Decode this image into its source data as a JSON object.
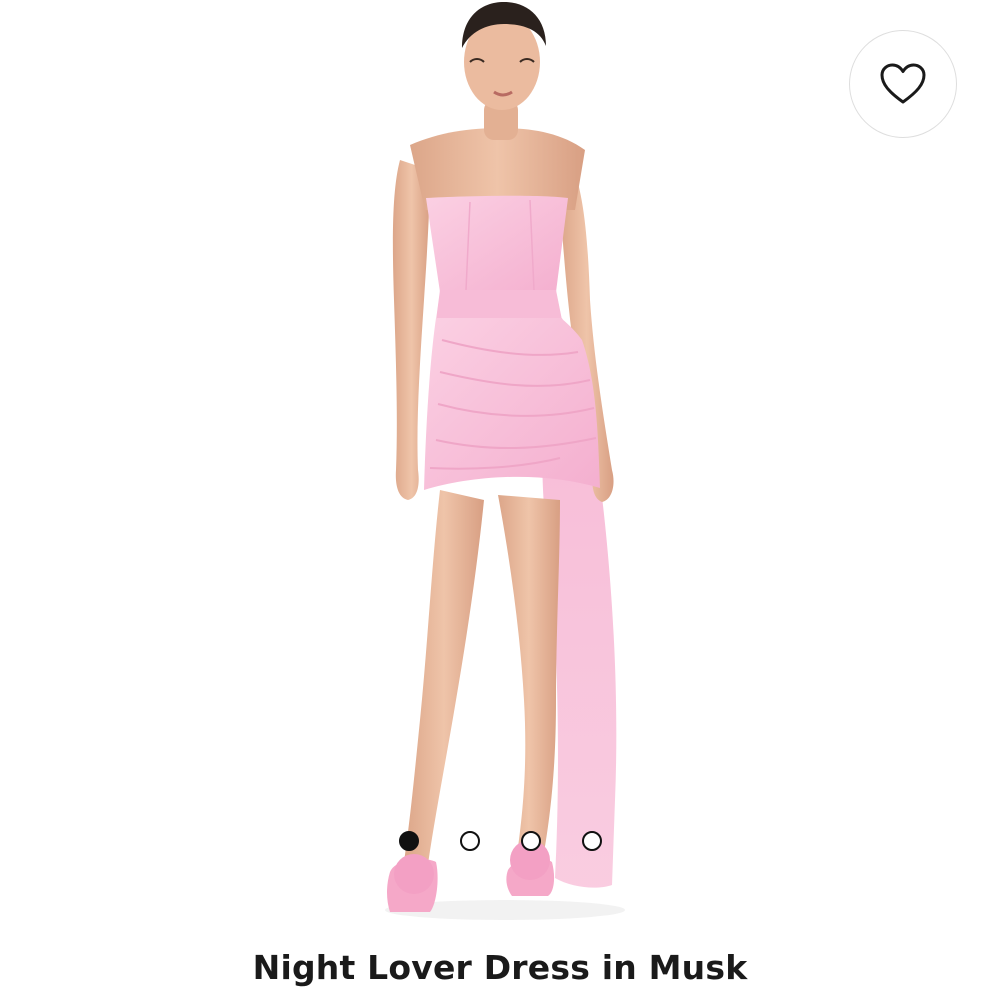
{
  "product": {
    "title": "Night Lover Dress in Musk",
    "image_alt": "Model wearing pink strapless draped mini dress with chiffon train"
  },
  "favorite": {
    "icon": "heart-outline-icon"
  },
  "carousel": {
    "total": 4,
    "active_index": 0
  },
  "colors": {
    "dress": "#f8bfd9",
    "skin": "#e9b79a",
    "hair": "#2a211d",
    "dot_active": "#111111",
    "title_text": "#1a1a1a"
  }
}
